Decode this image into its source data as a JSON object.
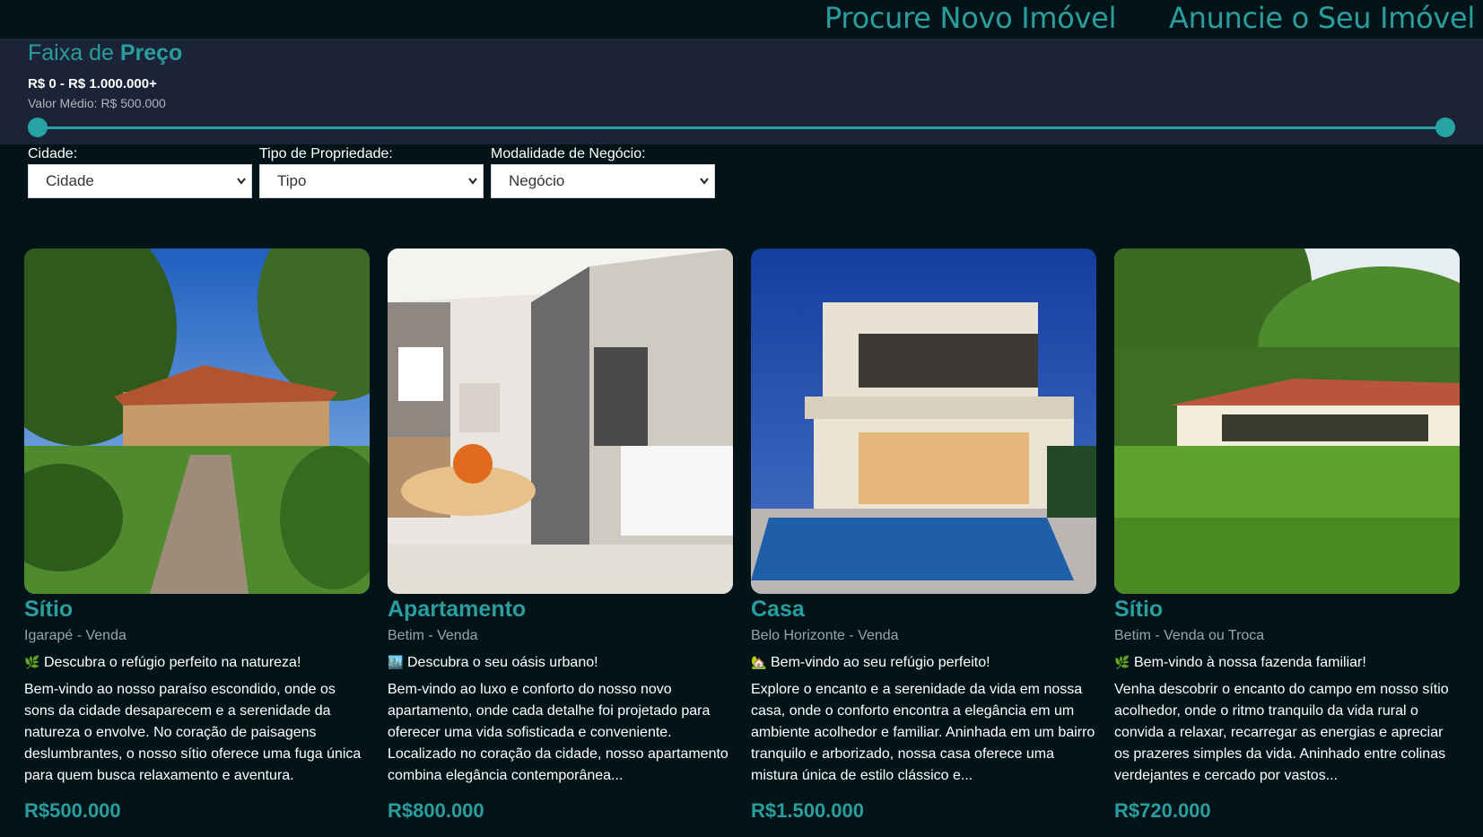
{
  "nav": {
    "search_label": "Procure Novo Imóvel",
    "advertise_label": "Anuncie o Seu Imóvel"
  },
  "price_filter": {
    "title_prefix": "Faixa de",
    "title_bold": "Preço",
    "range_text": "R$ 0 - R$ 1.000.000+",
    "average_text": "Valor Médio: R$ 500.000",
    "min_fraction": 0,
    "max_fraction": 1
  },
  "filters": {
    "city": {
      "label": "Cidade:",
      "selected": "Cidade"
    },
    "type": {
      "label": "Tipo de Propriedade:",
      "selected": "Tipo"
    },
    "deal": {
      "label": "Modalidade de Negócio:",
      "selected": "Negócio"
    }
  },
  "listings": [
    {
      "title": "Sítio",
      "location": "Igarapé - Venda",
      "emoji": "🌿",
      "tagline": "Descubra o refúgio perfeito na natureza!",
      "description": "Bem-vindo ao nosso paraíso escondido, onde os sons da cidade desaparecem e a serenidade da natureza o envolve. No coração de paisagens deslumbrantes, o nosso sítio oferece uma fuga única para quem busca relaxamento e aventura.",
      "price": "R$500.000"
    },
    {
      "title": "Apartamento",
      "location": "Betim - Venda",
      "emoji": "🏙️",
      "tagline": "Descubra o seu oásis urbano!",
      "description": "Bem-vindo ao luxo e conforto do nosso novo apartamento, onde cada detalhe foi projetado para oferecer uma vida sofisticada e conveniente. Localizado no coração da cidade, nosso apartamento combina elegância contemporânea...",
      "price": "R$800.000"
    },
    {
      "title": "Casa",
      "location": "Belo Horizonte - Venda",
      "emoji": "🏡",
      "tagline": "Bem-vindo ao seu refúgio perfeito!",
      "description": "Explore o encanto e a serenidade da vida em nossa casa, onde o conforto encontra a elegância em um ambiente acolhedor e familiar. Aninhada em um bairro tranquilo e arborizado, nossa casa oferece uma mistura única de estilo clássico e...",
      "price": "R$1.500.000"
    },
    {
      "title": "Sítio",
      "location": "Betim - Venda ou Troca",
      "emoji": "🌿",
      "tagline": "Bem-vindo à nossa fazenda familiar!",
      "description": "Venha descobrir o encanto do campo em nosso sítio acolhedor, onde o ritmo tranquilo da vida rural o convida a relaxar, recarregar as energias e apreciar os prazeres simples da vida. Aninhado entre colinas verdejantes e cercado por vastos...",
      "price": "R$720.000"
    }
  ]
}
